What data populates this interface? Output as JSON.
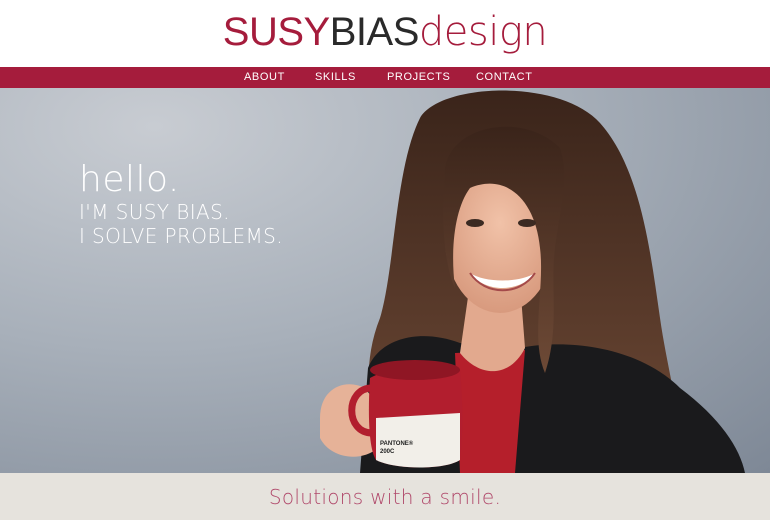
{
  "logo": {
    "part1": "SUSY",
    "part2": "BIAS",
    "part3": "design"
  },
  "nav": {
    "items": [
      "ABOUT",
      "SKILLS",
      "PROJECTS",
      "CONTACT"
    ]
  },
  "hero": {
    "greeting": "hello.",
    "line1": "I'M SUSY BIAS.",
    "line2": "I SOLVE PROBLEMS.",
    "mug_text1": "PANTONE®",
    "mug_text2": "200C"
  },
  "footer": {
    "tagline": "Solutions with a smile."
  },
  "colors": {
    "brand": "#a51c3c",
    "band": "#e6e3dd",
    "tagline": "#b0486a"
  }
}
